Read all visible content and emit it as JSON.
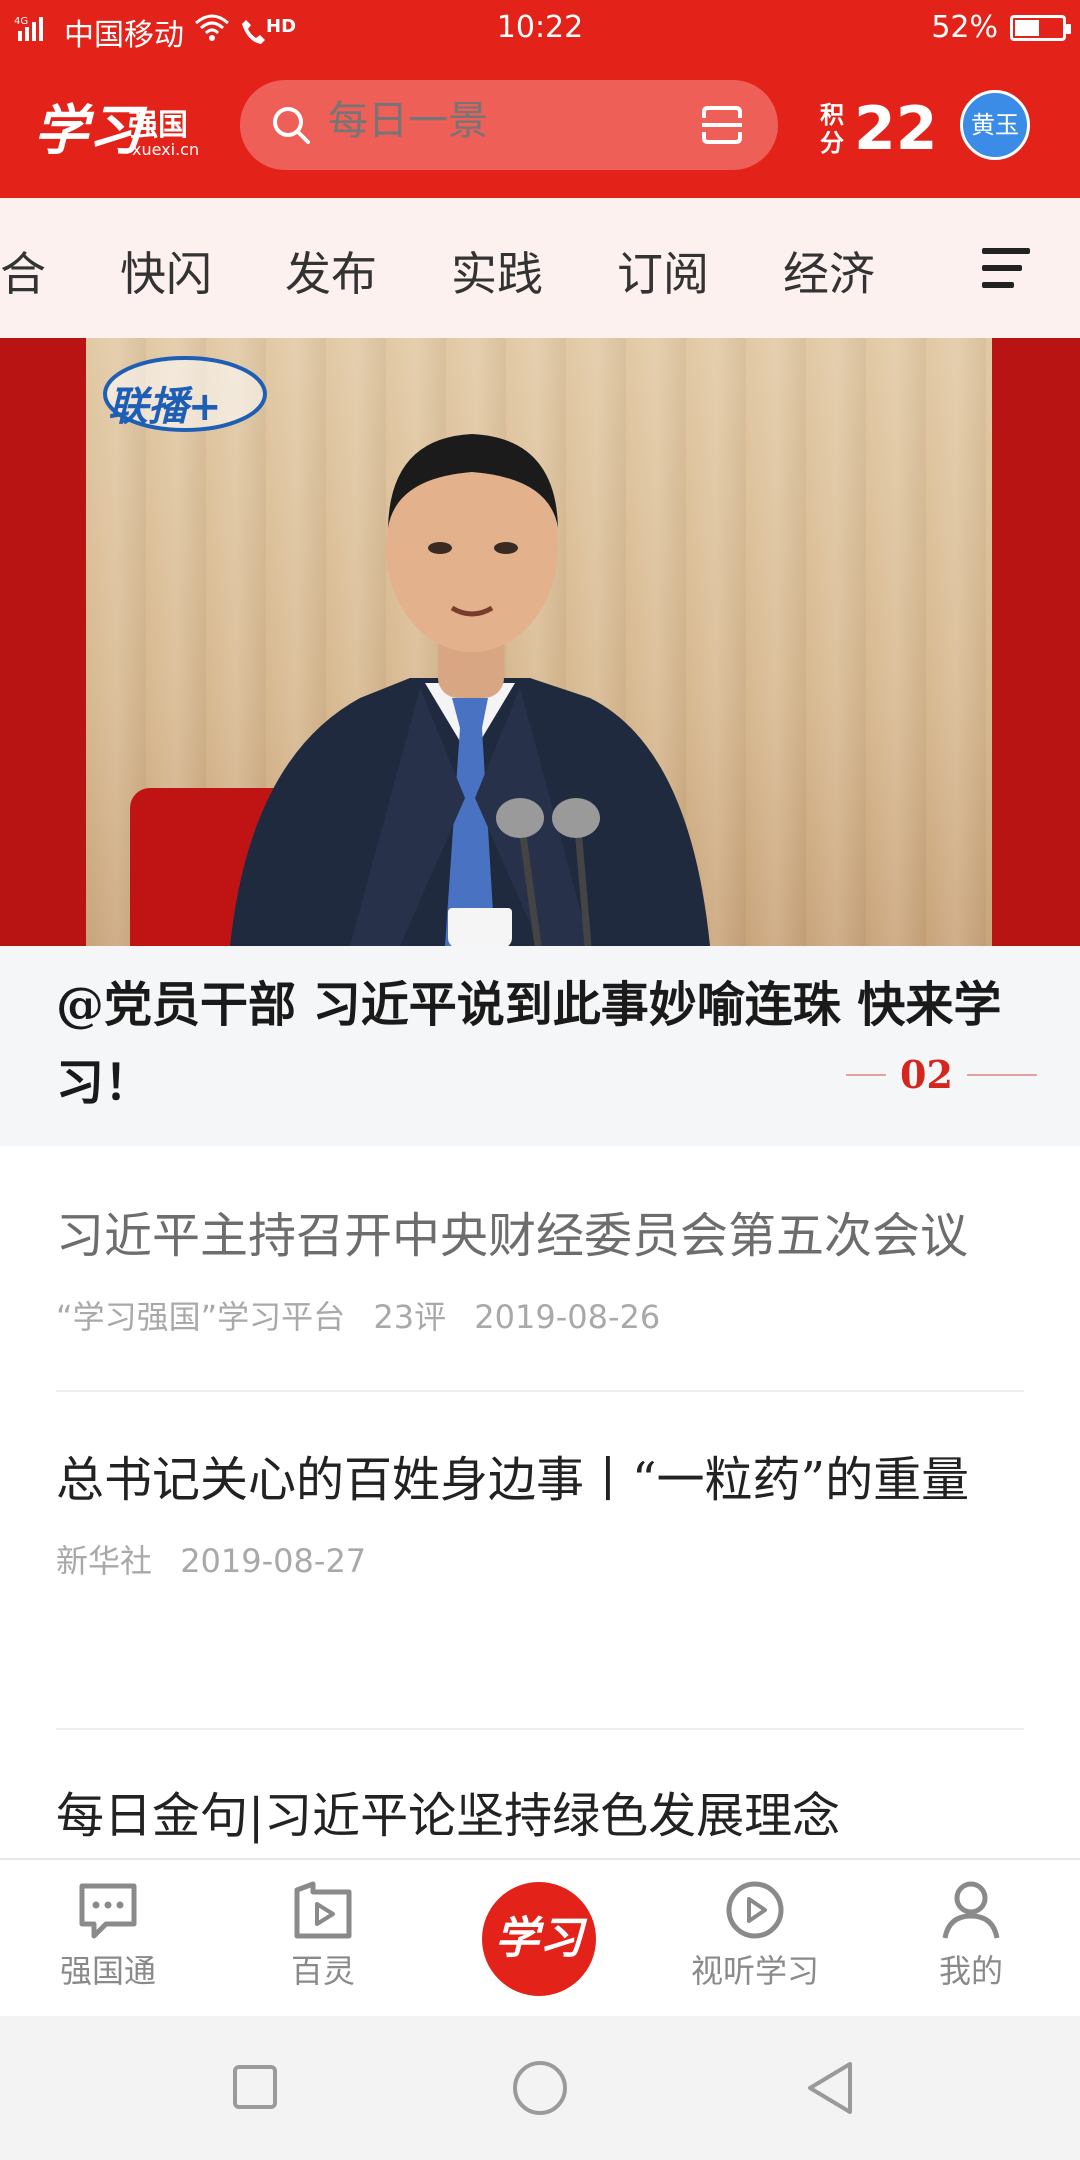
{
  "status_bar": {
    "network": "4G",
    "carrier": "中国移动",
    "hd": "HD",
    "time": "10:22",
    "battery_percent": "52%",
    "battery_level": 0.52
  },
  "header": {
    "logo_text": "学习",
    "logo_sub": "强国",
    "logo_url": "xuexi.cn",
    "search_placeholder": "每日一景",
    "score_label": "积分",
    "score_value": "22",
    "avatar_text": "黄玉"
  },
  "tabs": [
    "合",
    "快闪",
    "发布",
    "实践",
    "订阅",
    "经济"
  ],
  "hero": {
    "badge": "联播+",
    "title": "@党员干部 习近平说到此事妙喻连珠 快来学习！",
    "page_indicator": "02"
  },
  "news": [
    {
      "title": "习近平主持召开中央财经委员会第五次会议",
      "source": "“学习强国”学习平台",
      "comments": "23评",
      "date": "2019-08-26",
      "read": true
    },
    {
      "title": "总书记关心的百姓身边事丨“一粒药”的重量",
      "source": "新华社",
      "comments": "",
      "date": "2019-08-27",
      "read": false
    },
    {
      "title": "每日金句|习近平论坚持绿色发展理念",
      "source": "",
      "comments": "",
      "date": "",
      "read": false
    }
  ],
  "bottom_nav": {
    "items": [
      {
        "label": "强国通",
        "icon": "chat-icon"
      },
      {
        "label": "百灵",
        "icon": "play-folder-icon"
      },
      {
        "label": "学习",
        "icon": "study-logo-icon"
      },
      {
        "label": "视听学习",
        "icon": "play-circle-icon"
      },
      {
        "label": "我的",
        "icon": "user-icon"
      }
    ]
  },
  "system_nav": [
    "square-icon",
    "circle-icon",
    "back-triangle-icon"
  ],
  "colors": {
    "brand_red": "#e3231a",
    "tabs_bg": "#fdf1ef",
    "avatar_blue": "#3b8ce6"
  }
}
